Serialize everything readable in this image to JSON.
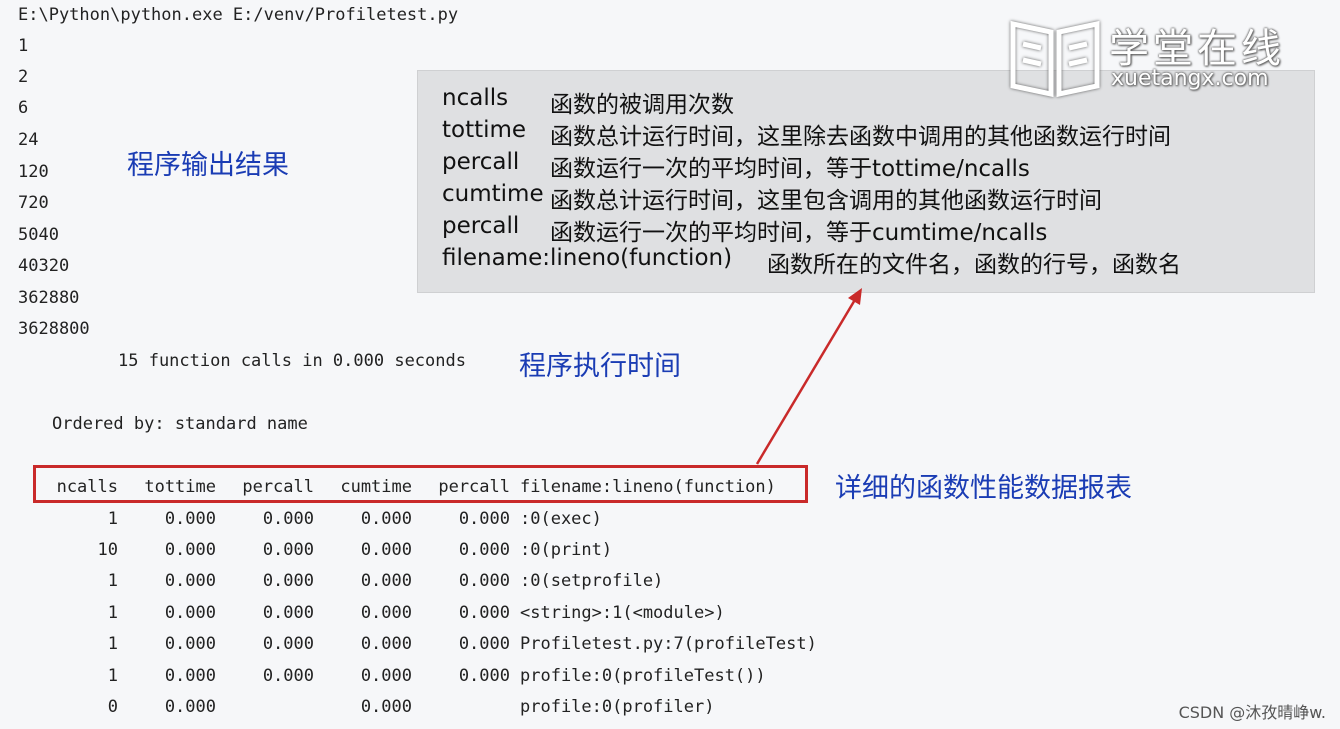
{
  "console": {
    "command": "E:\\Python\\python.exe E:/venv/Profiletest.py",
    "output_lines": [
      "1",
      "2",
      "6",
      "24",
      "120",
      "720",
      "5040",
      "40320",
      "362880",
      "3628800"
    ],
    "summary": "15 function calls in 0.000 seconds",
    "ordered_by": "Ordered by: standard name"
  },
  "labels": {
    "program_output": "程序输出结果",
    "exec_time": "程序执行时间",
    "report": "详细的函数性能数据报表"
  },
  "annotation": {
    "rows": [
      {
        "term": "ncalls",
        "desc": "函数的被调用次数"
      },
      {
        "term": "tottime",
        "desc": "函数总计运行时间，这里除去函数中调用的其他函数运行时间"
      },
      {
        "term": "percall",
        "desc": "函数运行一次的平均时间，等于tottime/ncalls"
      },
      {
        "term": "cumtime",
        "desc": "函数总计运行时间，这里包含调用的其他函数运行时间"
      },
      {
        "term": "percall",
        "desc": "函数运行一次的平均时间，等于cumtime/ncalls"
      },
      {
        "term": "filename:lineno(function)",
        "desc": "函数所在的文件名，函数的行号，函数名"
      }
    ]
  },
  "table": {
    "headers": [
      "ncalls",
      "tottime",
      "percall",
      "cumtime",
      "percall",
      "filename:lineno(function)"
    ],
    "rows": [
      [
        "1",
        "0.000",
        "0.000",
        "0.000",
        "0.000",
        ":0(exec)"
      ],
      [
        "10",
        "0.000",
        "0.000",
        "0.000",
        "0.000",
        ":0(print)"
      ],
      [
        "1",
        "0.000",
        "0.000",
        "0.000",
        "0.000",
        ":0(setprofile)"
      ],
      [
        "1",
        "0.000",
        "0.000",
        "0.000",
        "0.000",
        "<string>:1(<module>)"
      ],
      [
        "1",
        "0.000",
        "0.000",
        "0.000",
        "0.000",
        "Profiletest.py:7(profileTest)"
      ],
      [
        "1",
        "0.000",
        "0.000",
        "0.000",
        "0.000",
        "profile:0(profileTest())"
      ],
      [
        "0",
        "0.000",
        "",
        "0.000",
        "",
        "profile:0(profiler)"
      ]
    ]
  },
  "logo": {
    "name_zh": "学堂在线",
    "name_en": "xuetangx.com"
  },
  "watermark": "CSDN @沐孜晴峥w.",
  "colors": {
    "highlight_border": "#c92a2a",
    "label_blue": "#1a3cb4",
    "annotation_bg": "#dfe0e2"
  }
}
